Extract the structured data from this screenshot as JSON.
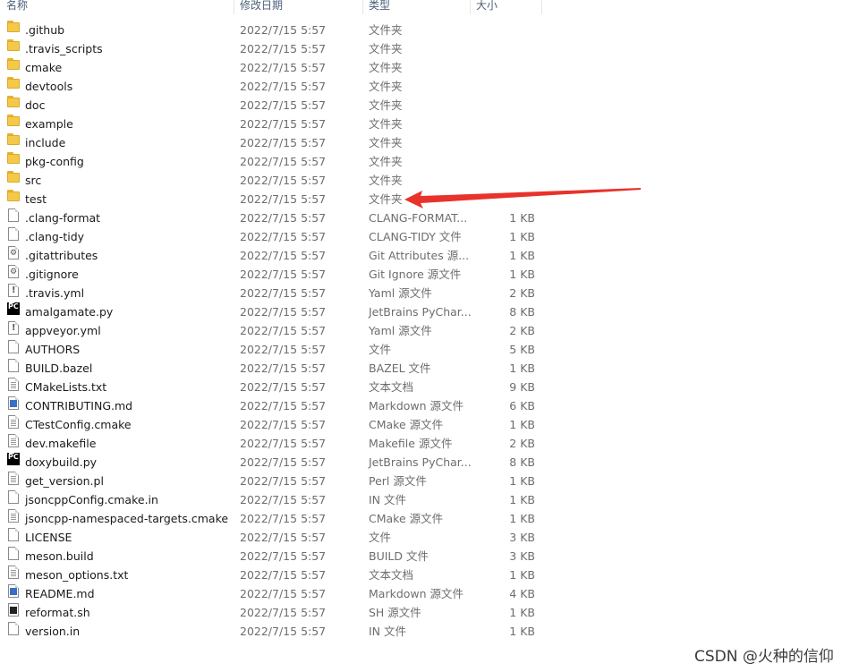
{
  "columns": {
    "name": "名称",
    "date": "修改日期",
    "type": "类型",
    "size": "大小"
  },
  "files": [
    {
      "name": ".github",
      "date": "2022/7/15 5:57",
      "type": "文件夹",
      "size": "",
      "icon": "folder-icon"
    },
    {
      "name": ".travis_scripts",
      "date": "2022/7/15 5:57",
      "type": "文件夹",
      "size": "",
      "icon": "folder-icon"
    },
    {
      "name": "cmake",
      "date": "2022/7/15 5:57",
      "type": "文件夹",
      "size": "",
      "icon": "folder-icon"
    },
    {
      "name": "devtools",
      "date": "2022/7/15 5:57",
      "type": "文件夹",
      "size": "",
      "icon": "folder-icon"
    },
    {
      "name": "doc",
      "date": "2022/7/15 5:57",
      "type": "文件夹",
      "size": "",
      "icon": "folder-icon"
    },
    {
      "name": "example",
      "date": "2022/7/15 5:57",
      "type": "文件夹",
      "size": "",
      "icon": "folder-icon"
    },
    {
      "name": "include",
      "date": "2022/7/15 5:57",
      "type": "文件夹",
      "size": "",
      "icon": "folder-icon"
    },
    {
      "name": "pkg-config",
      "date": "2022/7/15 5:57",
      "type": "文件夹",
      "size": "",
      "icon": "folder-icon"
    },
    {
      "name": "src",
      "date": "2022/7/15 5:57",
      "type": "文件夹",
      "size": "",
      "icon": "folder-icon"
    },
    {
      "name": "test",
      "date": "2022/7/15 5:57",
      "type": "文件夹",
      "size": "",
      "icon": "folder-icon"
    },
    {
      "name": ".clang-format",
      "date": "2022/7/15 5:57",
      "type": "CLANG-FORMAT...",
      "size": "1 KB",
      "icon": "file-icon"
    },
    {
      "name": ".clang-tidy",
      "date": "2022/7/15 5:57",
      "type": "CLANG-TIDY 文件",
      "size": "1 KB",
      "icon": "file-icon"
    },
    {
      "name": ".gitattributes",
      "date": "2022/7/15 5:57",
      "type": "Git Attributes 源...",
      "size": "1 KB",
      "icon": "config-file-icon"
    },
    {
      "name": ".gitignore",
      "date": "2022/7/15 5:57",
      "type": "Git Ignore 源文件",
      "size": "1 KB",
      "icon": "config-file-icon"
    },
    {
      "name": ".travis.yml",
      "date": "2022/7/15 5:57",
      "type": "Yaml 源文件",
      "size": "2 KB",
      "icon": "yaml-file-icon"
    },
    {
      "name": "amalgamate.py",
      "date": "2022/7/15 5:57",
      "type": "JetBrains PyChar...",
      "size": "8 KB",
      "icon": "pycharm-icon"
    },
    {
      "name": "appveyor.yml",
      "date": "2022/7/15 5:57",
      "type": "Yaml 源文件",
      "size": "2 KB",
      "icon": "yaml-file-icon"
    },
    {
      "name": "AUTHORS",
      "date": "2022/7/15 5:57",
      "type": "文件",
      "size": "5 KB",
      "icon": "file-icon"
    },
    {
      "name": "BUILD.bazel",
      "date": "2022/7/15 5:57",
      "type": "BAZEL 文件",
      "size": "1 KB",
      "icon": "file-icon"
    },
    {
      "name": "CMakeLists.txt",
      "date": "2022/7/15 5:57",
      "type": "文本文档",
      "size": "9 KB",
      "icon": "text-file-icon"
    },
    {
      "name": "CONTRIBUTING.md",
      "date": "2022/7/15 5:57",
      "type": "Markdown 源文件",
      "size": "6 KB",
      "icon": "markdown-file-icon"
    },
    {
      "name": "CTestConfig.cmake",
      "date": "2022/7/15 5:57",
      "type": "CMake 源文件",
      "size": "1 KB",
      "icon": "text-file-icon"
    },
    {
      "name": "dev.makefile",
      "date": "2022/7/15 5:57",
      "type": "Makefile 源文件",
      "size": "2 KB",
      "icon": "text-file-icon"
    },
    {
      "name": "doxybuild.py",
      "date": "2022/7/15 5:57",
      "type": "JetBrains PyChar...",
      "size": "8 KB",
      "icon": "pycharm-icon"
    },
    {
      "name": "get_version.pl",
      "date": "2022/7/15 5:57",
      "type": "Perl 源文件",
      "size": "1 KB",
      "icon": "text-file-icon"
    },
    {
      "name": "jsoncppConfig.cmake.in",
      "date": "2022/7/15 5:57",
      "type": "IN 文件",
      "size": "1 KB",
      "icon": "file-icon"
    },
    {
      "name": "jsoncpp-namespaced-targets.cmake",
      "date": "2022/7/15 5:57",
      "type": "CMake 源文件",
      "size": "1 KB",
      "icon": "text-file-icon"
    },
    {
      "name": "LICENSE",
      "date": "2022/7/15 5:57",
      "type": "文件",
      "size": "3 KB",
      "icon": "file-icon"
    },
    {
      "name": "meson.build",
      "date": "2022/7/15 5:57",
      "type": "BUILD 文件",
      "size": "3 KB",
      "icon": "file-icon"
    },
    {
      "name": "meson_options.txt",
      "date": "2022/7/15 5:57",
      "type": "文本文档",
      "size": "1 KB",
      "icon": "text-file-icon"
    },
    {
      "name": "README.md",
      "date": "2022/7/15 5:57",
      "type": "Markdown 源文件",
      "size": "4 KB",
      "icon": "markdown-file-icon"
    },
    {
      "name": "reformat.sh",
      "date": "2022/7/15 5:57",
      "type": "SH 源文件",
      "size": "1 KB",
      "icon": "shell-script-icon"
    },
    {
      "name": "version.in",
      "date": "2022/7/15 5:57",
      "type": "IN 文件",
      "size": "1 KB",
      "icon": "file-icon"
    }
  ],
  "annotation": {
    "arrow_color": "#e8322b",
    "points_to": "test"
  },
  "watermark": "CSDN @火种的信仰"
}
